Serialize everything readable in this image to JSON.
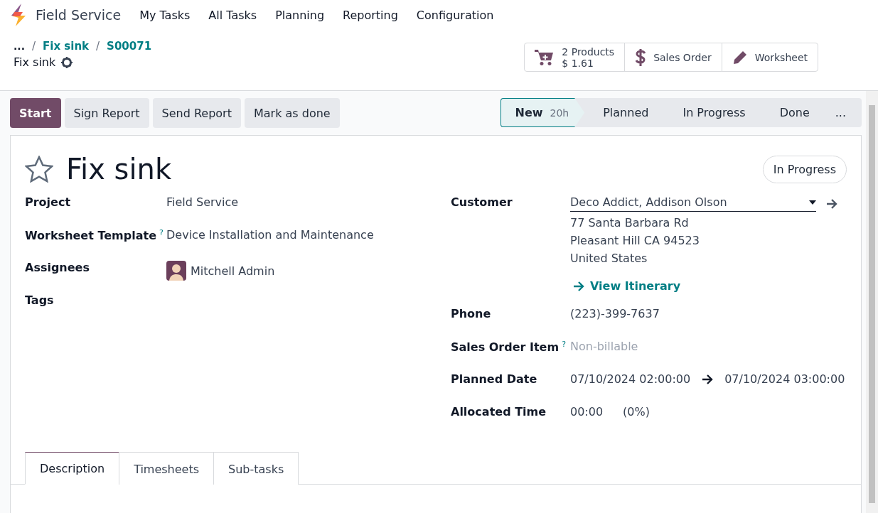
{
  "navbar": {
    "app_name": "Field Service",
    "menu": [
      {
        "label": "My Tasks"
      },
      {
        "label": "All Tasks"
      },
      {
        "label": "Planning"
      },
      {
        "label": "Reporting"
      },
      {
        "label": "Configuration"
      }
    ]
  },
  "breadcrumbs": {
    "more": "...",
    "separator": "/",
    "items": [
      {
        "label": "Fix sink"
      },
      {
        "label": "S00071"
      }
    ],
    "current": "Fix sink"
  },
  "smart_buttons": [
    {
      "kind": "cart",
      "lines": [
        "2 Products",
        "$ 1.61"
      ]
    },
    {
      "kind": "dollar",
      "lines": [
        "Sales Order"
      ]
    },
    {
      "kind": "pencil",
      "lines": [
        "Worksheet"
      ]
    }
  ],
  "actions": [
    {
      "label": "Start",
      "kind": "primary"
    },
    {
      "label": "Sign Report",
      "kind": "secondary"
    },
    {
      "label": "Send Report",
      "kind": "secondary"
    },
    {
      "label": "Mark as done",
      "kind": "secondary"
    }
  ],
  "stages": [
    {
      "label": "New",
      "duration": "20h",
      "selected": true
    },
    {
      "label": "Planned",
      "selected": false
    },
    {
      "label": "In Progress",
      "selected": false
    },
    {
      "label": "Done",
      "selected": false
    }
  ],
  "stages_more": "...",
  "form": {
    "title": "Fix sink",
    "starred": false,
    "state_badge": "In Progress",
    "left_fields": [
      {
        "label": "Project",
        "kind": "text",
        "value": "Field Service"
      },
      {
        "label": "Worksheet Template",
        "help": "?",
        "kind": "text",
        "value": "Device Installation and Maintenance"
      },
      {
        "label": "Assignees",
        "kind": "user",
        "value": "Mitchell Admin"
      },
      {
        "label": "Tags",
        "kind": "empty"
      }
    ],
    "right_fields": [
      {
        "label": "Customer",
        "kind": "customer",
        "value": "Deco Addict, Addison Olson",
        "address": [
          "77 Santa Barbara Rd",
          "Pleasant Hill CA 94523",
          "United States"
        ],
        "link": "View Itinerary"
      },
      {
        "label": "Phone",
        "kind": "text",
        "value": "(223)-399-7637"
      },
      {
        "label": "Sales Order Item",
        "help": "?",
        "kind": "muted",
        "placeholder": "Non-billable"
      },
      {
        "label": "Planned Date",
        "kind": "range",
        "value": "07/10/2024 02:00:00",
        "end": "07/10/2024 03:00:00"
      },
      {
        "label": "Allocated Time",
        "kind": "time",
        "value": "00:00",
        "percent": "(0%)"
      }
    ]
  },
  "tabs": [
    {
      "label": "Description",
      "selected": true
    },
    {
      "label": "Timesheets",
      "selected": false
    },
    {
      "label": "Sub-tasks",
      "selected": false
    }
  ]
}
